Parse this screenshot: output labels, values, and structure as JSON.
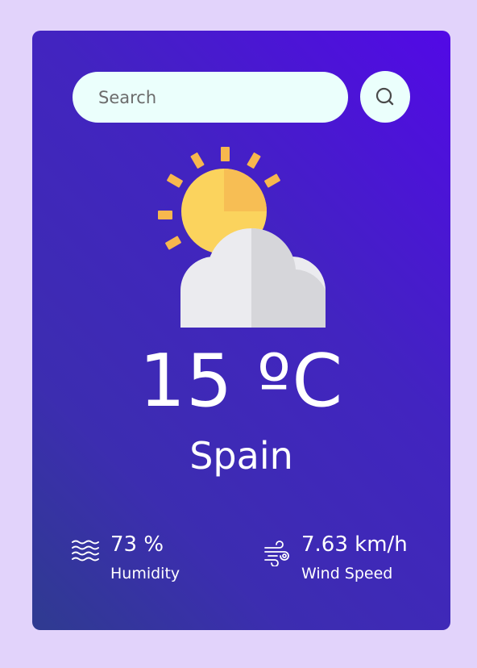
{
  "search": {
    "placeholder": "Search",
    "button_icon": "search-icon"
  },
  "weather": {
    "icon": "partly-cloudy-rain-icon",
    "temperature": "15 ºC",
    "city": "Spain"
  },
  "humidity": {
    "icon": "humidity-waves-icon",
    "value": "73 %",
    "label": "Humidity"
  },
  "wind": {
    "icon": "wind-icon",
    "value": "7.63 km/h",
    "label": "Wind Speed"
  },
  "colors": {
    "page_background": "#e2d3fb",
    "card_gradient_start": "#5209e6",
    "card_gradient_end": "#2f3b90",
    "search_background": "#ebfffc",
    "text": "#ffffff"
  }
}
